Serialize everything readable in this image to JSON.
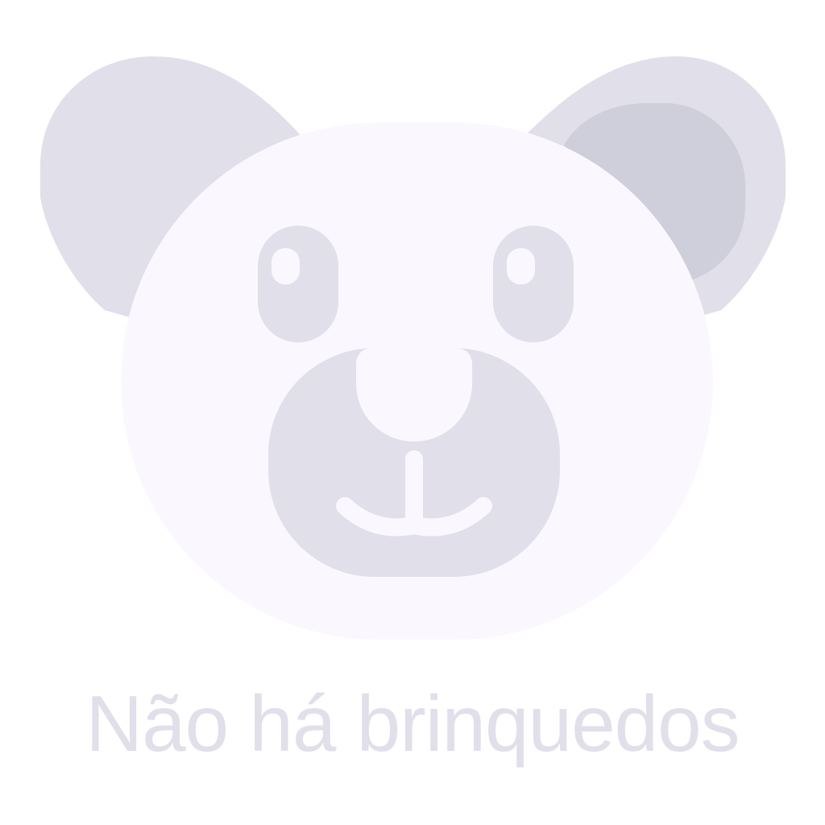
{
  "empty_state": {
    "message": "Não há brinquedos",
    "icon": "teddy-bear-icon"
  },
  "colors": {
    "background": "#ffffff",
    "face": "#faf8fe",
    "shape": "#e1dfea",
    "inner_ear": "#cfcedb",
    "text": "#e1dfea"
  }
}
